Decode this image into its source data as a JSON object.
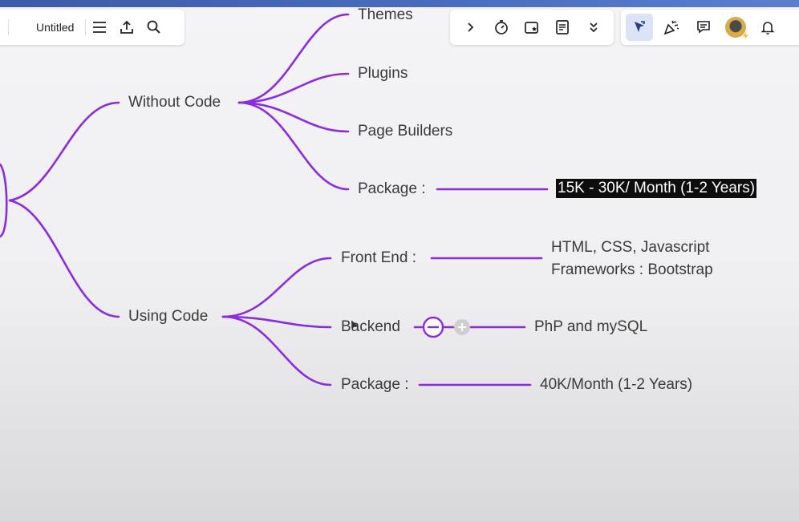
{
  "toolbar": {
    "doc_title": "Untitled"
  },
  "mindmap": {
    "branch_without_code": "Without Code",
    "themes": "Themes",
    "plugins": "Plugins",
    "page_builders": "Page Builders",
    "package_1": "Package :",
    "price_1": "15K - 30K/ Month (1-2 Years)",
    "branch_using_code": "Using Code",
    "front_end": "Front End :",
    "front_end_tech_line1": "HTML, CSS, Javascript",
    "front_end_tech_line2": "Frameworks : Bootstrap",
    "backend": "Backend",
    "backend_tech": "PhP and mySQL",
    "package_2": "Package :",
    "price_2": "40K/Month (1-2 Years)"
  },
  "colors": {
    "branch": "#8a2be2",
    "highlight_bg": "#0d0d0d",
    "active_tool_bg": "#dde3f6"
  }
}
